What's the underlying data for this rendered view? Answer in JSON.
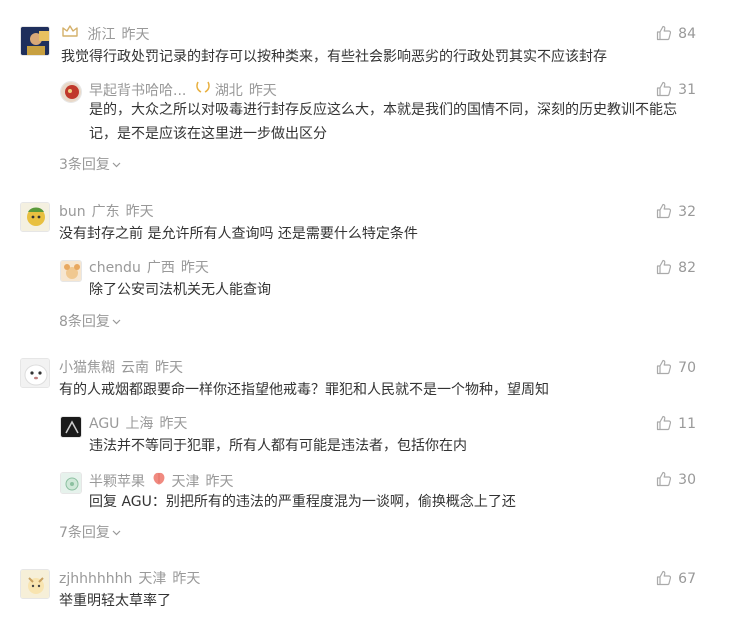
{
  "comments": [
    {
      "nick": "",
      "location": "浙江",
      "time": "昨天",
      "text": "我觉得行政处罚记录的封存可以按种类来，有些社会影响恶劣的行政处罚其实不应该封存",
      "likes": "84",
      "reply": {
        "nick": "早起背书哈哈...",
        "location": "湖北",
        "time": "昨天",
        "text": "是的，大众之所以对吸毒进行封存反应这么大，本就是我们的国情不同，深刻的历史教训不能忘记，是不是应该在这里进一步做出区分",
        "likes": "31"
      },
      "more": "3条回复"
    },
    {
      "nick": "bun",
      "location": "广东",
      "time": "昨天",
      "text": "没有封存之前 是允许所有人查询吗 还是需要什么特定条件",
      "likes": "32",
      "reply": {
        "nick": "chendu",
        "location": "广西",
        "time": "昨天",
        "text": "除了公安司法机关无人能查询",
        "likes": "82"
      },
      "more": "8条回复"
    },
    {
      "nick": "小猫焦糊",
      "location": "云南",
      "time": "昨天",
      "text": "有的人戒烟都跟要命一样你还指望他戒毒？罪犯和人民就不是一个物种，望周知",
      "likes": "70",
      "replies": [
        {
          "nick": "AGU",
          "location": "上海",
          "time": "昨天",
          "text": "违法并不等同于犯罪，所有人都有可能是违法者，包括你在内",
          "likes": "11"
        },
        {
          "nick": "半颗苹果",
          "location": "天津",
          "time": "昨天",
          "text": "回复 AGU：别把所有的违法的严重程度混为一谈啊，偷换概念上了还",
          "likes": "30"
        }
      ],
      "more": "7条回复"
    },
    {
      "nick": "zjhhhhhhh",
      "location": "天津",
      "time": "昨天",
      "text": "举重明轻太草率了",
      "likes": "67"
    }
  ]
}
